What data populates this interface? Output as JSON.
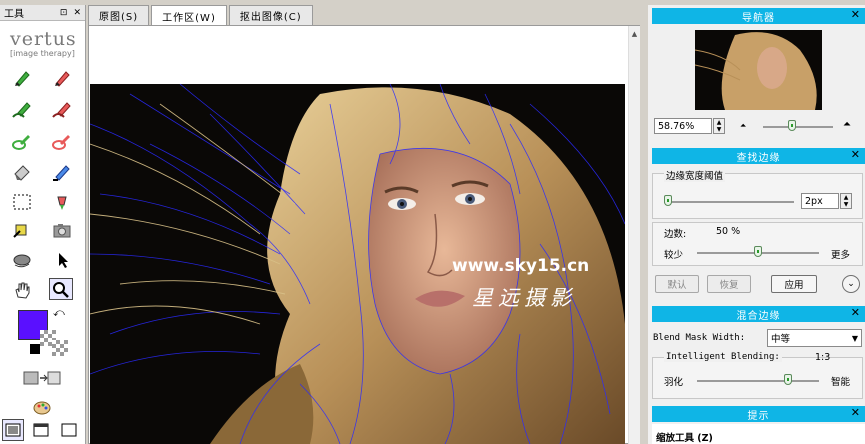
{
  "toolbox": {
    "title": "工具",
    "pin_glyph": "⊡",
    "close_glyph": "✕",
    "logo_big": "vertus",
    "logo_small": "[image therapy]"
  },
  "tabs": [
    {
      "label": "原图(S)"
    },
    {
      "label": "工作区(W)"
    },
    {
      "label": "抠出图像(C)"
    }
  ],
  "watermark": {
    "url": "www.sky15.cn",
    "text": "星远摄影"
  },
  "navigator": {
    "title": "导航器",
    "zoom_value": "58.76%"
  },
  "find_edges": {
    "title": "查找边缘",
    "threshold_label": "边缘宽度阈值",
    "threshold_value": "2px",
    "edges_label": "边数:",
    "edges_value": "50 %",
    "less_label": "较少",
    "more_label": "更多",
    "default_button": "默认",
    "restore_button": "恢复",
    "apply_button": "应用"
  },
  "blend_edges": {
    "title": "混合边缘",
    "mask_width_label": "Blend Mask Width:",
    "mask_width_value": "中等",
    "intelligent_label": "Intelligent Blending:",
    "ratio_value": "1:3",
    "feather_label": "羽化",
    "smart_label": "智能"
  },
  "tips": {
    "title": "提示",
    "zoom_tool_label": "缩放工具 (Z)"
  },
  "colors": {
    "panel_header": "#0fb5e6",
    "foreground": "#5a10ff",
    "edge_lines": "#2a2aff"
  }
}
